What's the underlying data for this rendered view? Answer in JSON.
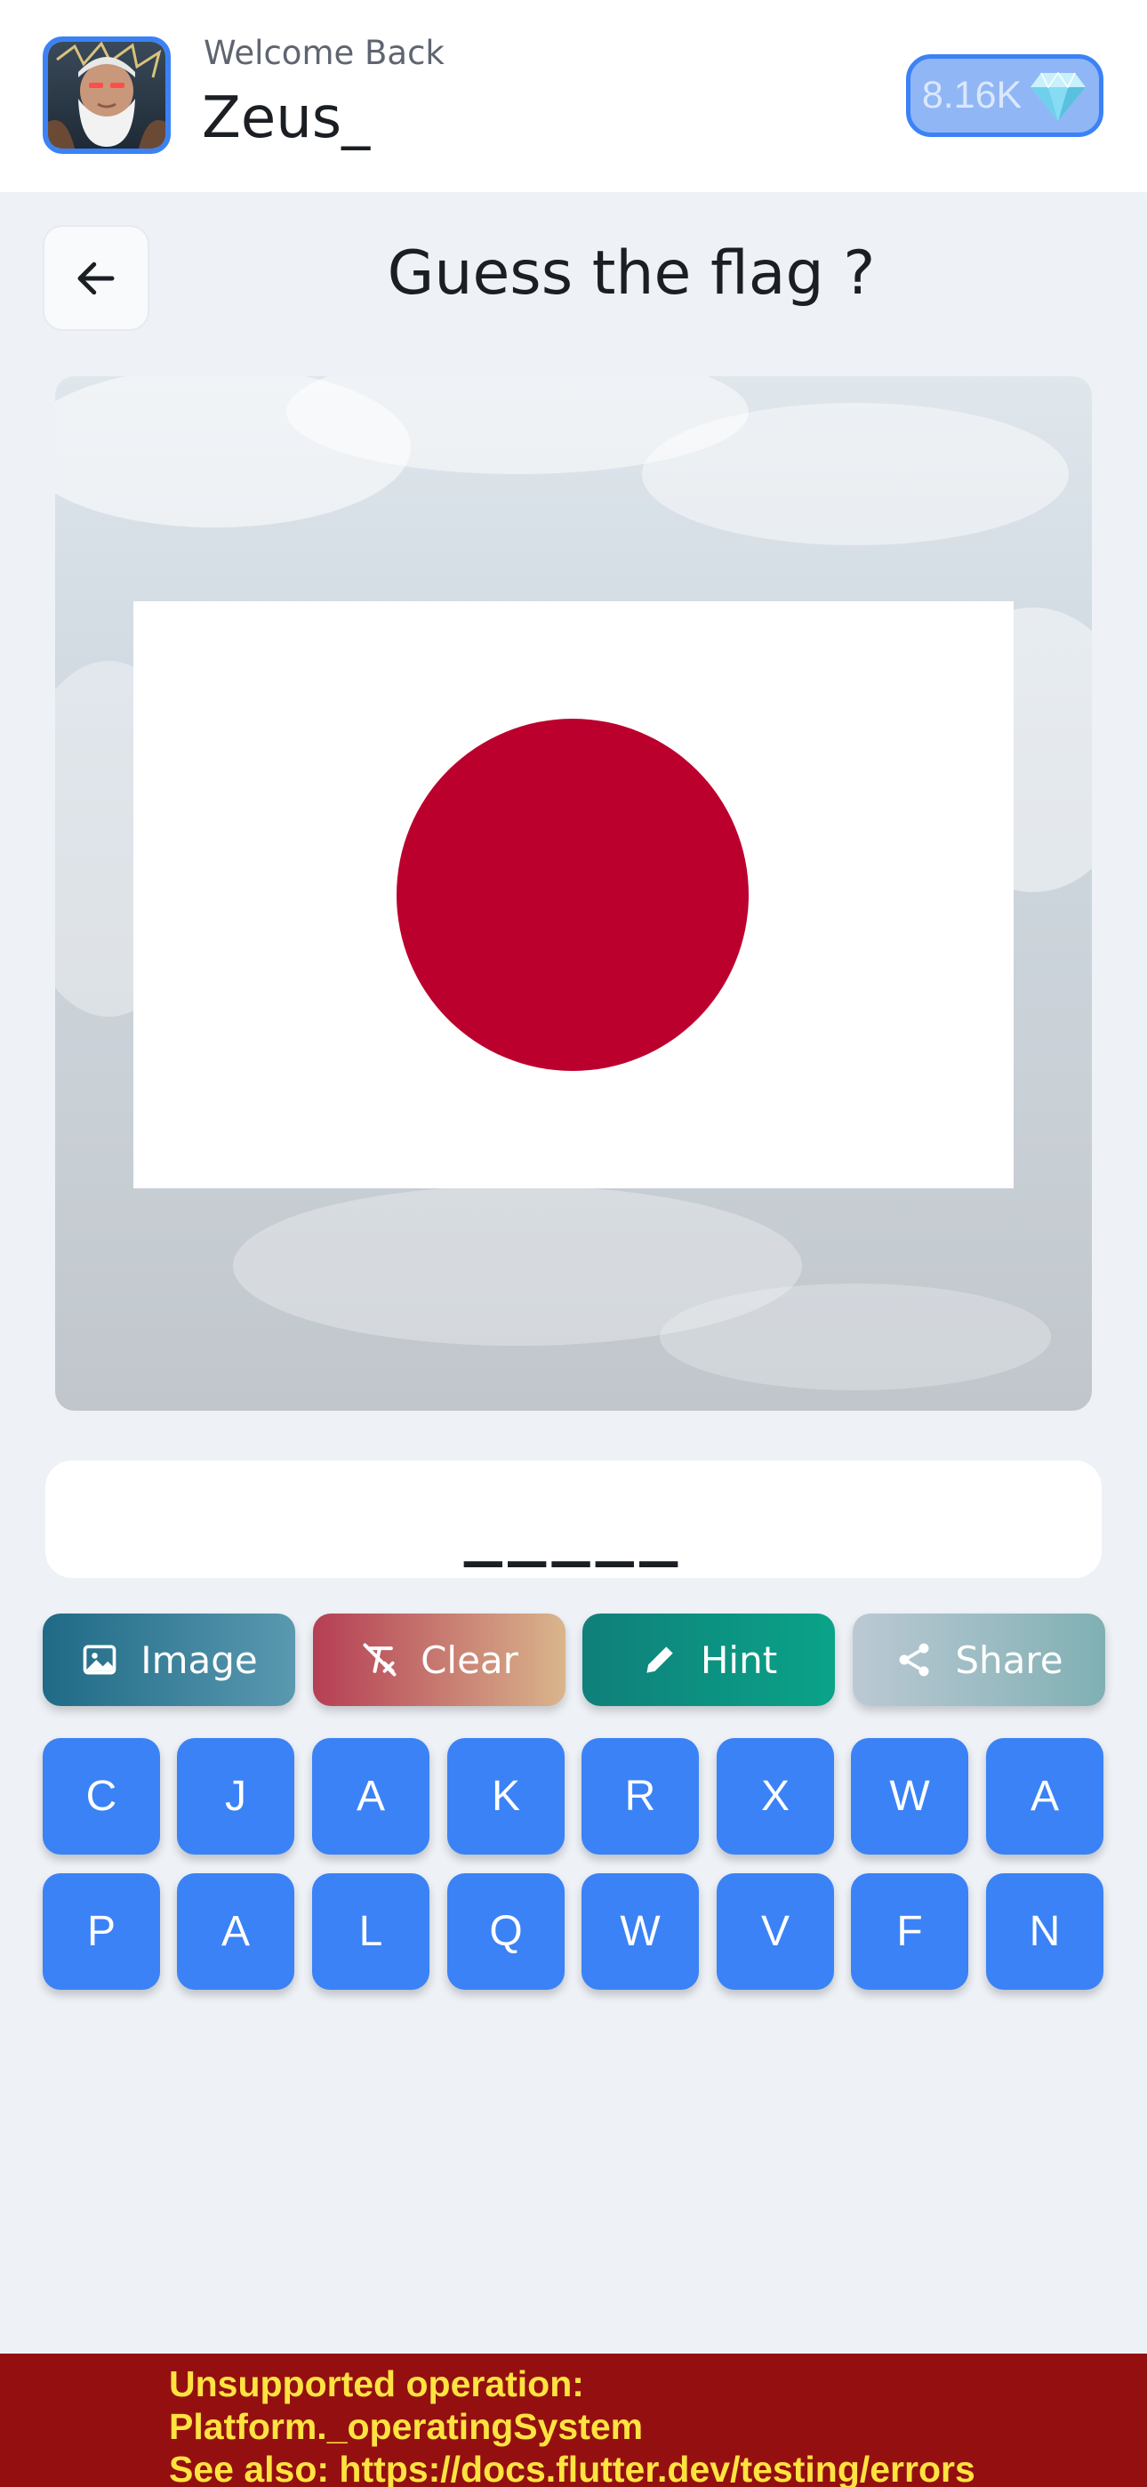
{
  "header": {
    "welcome_text": "Welcome Back",
    "username": "Zeus_",
    "gems": "8.16K",
    "avatar_icon": "zeus-avatar",
    "gem_icon": "diamond-icon"
  },
  "game": {
    "title": "Guess the flag ?",
    "answer_slots": "_____",
    "flag": {
      "name_hidden": true,
      "colors": {
        "field": "#ffffff",
        "disc": "#bc002d"
      }
    }
  },
  "actions": [
    {
      "label": "Image",
      "icon": "image-icon"
    },
    {
      "label": "Clear",
      "icon": "clear-format-icon"
    },
    {
      "label": "Hint",
      "icon": "pencil-icon"
    },
    {
      "label": "Share",
      "icon": "share-icon"
    }
  ],
  "keyboard": {
    "row1": [
      "C",
      "J",
      "A",
      "K",
      "R",
      "X",
      "W",
      "A"
    ],
    "row2": [
      "P",
      "A",
      "L",
      "Q",
      "W",
      "V",
      "F",
      "N"
    ]
  },
  "error": {
    "lines": [
      "Unsupported operation:",
      "Platform._operatingSystem",
      "See also: https://docs.flutter.dev/testing/errors"
    ]
  },
  "colors": {
    "accent": "#3b82f6",
    "background": "#eef2f7",
    "error_bg": "#941010",
    "error_text": "#ffe340"
  }
}
